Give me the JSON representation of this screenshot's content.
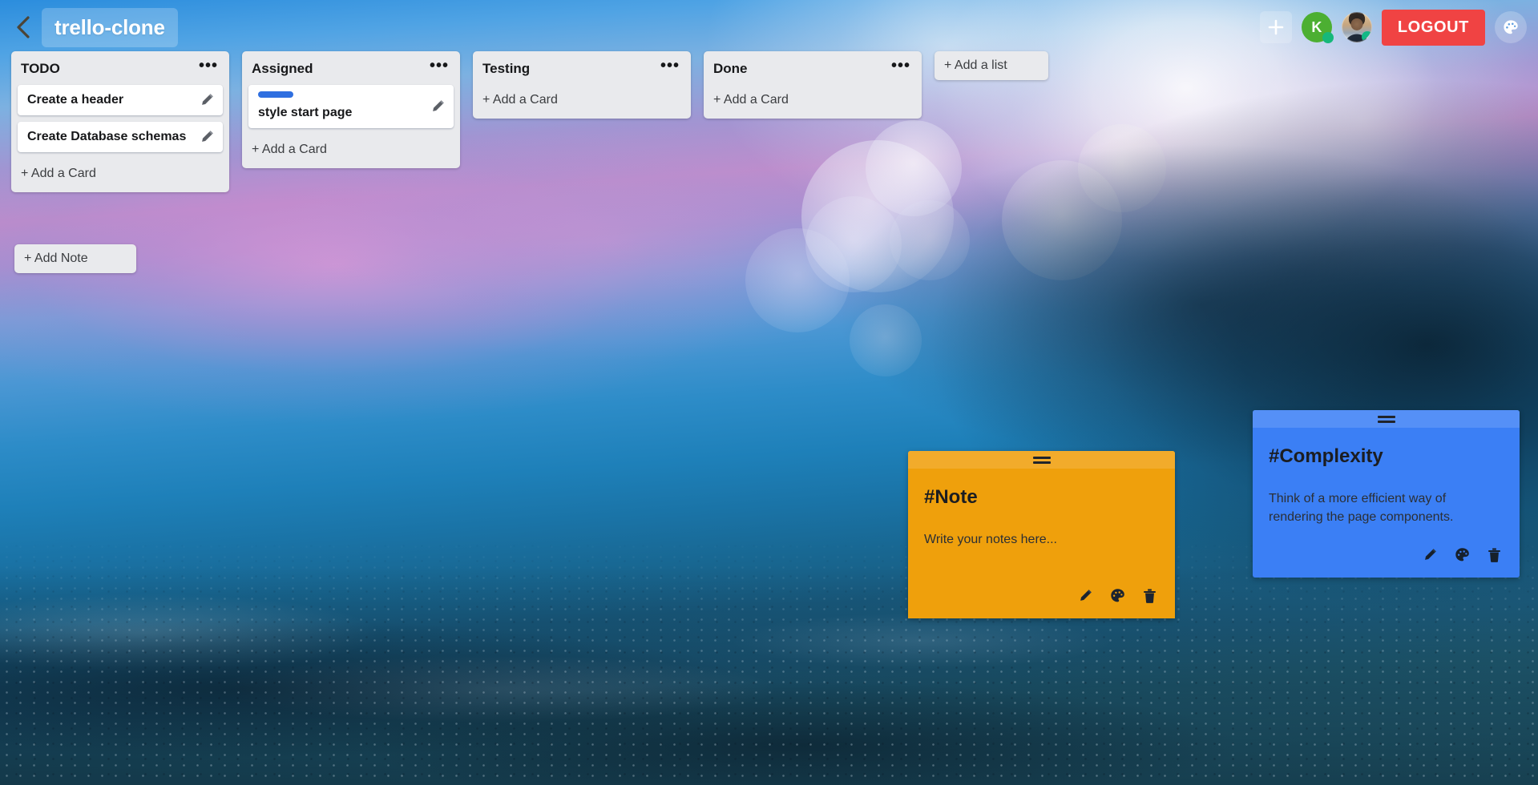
{
  "header": {
    "back_icon": "chevron-left-icon",
    "board_title": "trello-clone",
    "add_icon": "plus-icon",
    "avatars": [
      {
        "type": "letter",
        "label": "K",
        "status": "online"
      },
      {
        "type": "photo",
        "label": "",
        "status": "online"
      }
    ],
    "logout_label": "LOGOUT",
    "theme_icon": "palette-icon"
  },
  "board": {
    "lists": [
      {
        "title": "TODO",
        "menu_icon": "ellipsis-icon",
        "add_card_label": "+ Add a Card",
        "cards": [
          {
            "text": "Create a header",
            "label_color": "",
            "edit_icon": "pencil-icon"
          },
          {
            "text": "Create Database schemas",
            "label_color": "",
            "edit_icon": "pencil-icon"
          }
        ]
      },
      {
        "title": "Assigned",
        "menu_icon": "ellipsis-icon",
        "add_card_label": "+ Add a Card",
        "cards": [
          {
            "text": "style start page",
            "label_color": "#2f6fe0",
            "edit_icon": "pencil-icon"
          }
        ]
      },
      {
        "title": "Testing",
        "menu_icon": "ellipsis-icon",
        "add_card_label": "+ Add a Card",
        "cards": []
      },
      {
        "title": "Done",
        "menu_icon": "ellipsis-icon",
        "add_card_label": "+ Add a Card",
        "cards": []
      }
    ],
    "add_list_label": "+ Add a list",
    "add_note_label": "+ Add Note"
  },
  "notes": [
    {
      "title": "#Note",
      "body": "Write your notes here...",
      "color": "#efa00c",
      "handle_icon": "drag-handle-icon",
      "tools": [
        "pencil-icon",
        "palette-icon",
        "trash-icon"
      ]
    },
    {
      "title": "#Complexity",
      "body": "Think of a more efficient way of rendering the page components.",
      "color": "#3b7ff5",
      "handle_icon": "drag-handle-icon",
      "tools": [
        "pencil-icon",
        "palette-icon",
        "trash-icon"
      ]
    }
  ],
  "colors": {
    "logout_red": "#f04343",
    "label_blue": "#2f6fe0",
    "avatar_green": "#4caf32",
    "status_dot": "#16b87a",
    "list_bg": "#e9eaed"
  }
}
